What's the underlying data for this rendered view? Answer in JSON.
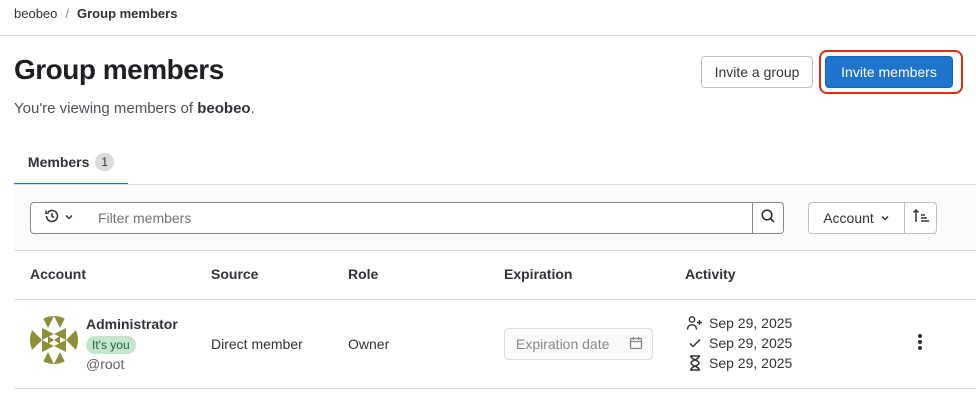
{
  "breadcrumb": {
    "group": "beobeo",
    "separator": "/",
    "current": "Group members"
  },
  "header": {
    "title": "Group members",
    "description_prefix": "You're viewing members of ",
    "description_group": "beobeo",
    "description_suffix": ".",
    "invite_group_label": "Invite a group",
    "invite_members_label": "Invite members"
  },
  "tabs": [
    {
      "label": "Members",
      "count": "1"
    }
  ],
  "filter": {
    "placeholder": "Filter members",
    "sort_label": "Account"
  },
  "table": {
    "columns": [
      "Account",
      "Source",
      "Role",
      "Expiration",
      "Activity"
    ],
    "rows": [
      {
        "name": "Administrator",
        "badge": "It's you",
        "username": "@root",
        "source": "Direct member",
        "role": "Owner",
        "expiration_placeholder": "Expiration date",
        "activity": {
          "member_since": "Sep 29, 2025",
          "last_activity": "Sep 29, 2025",
          "last_sign_in": "Sep 29, 2025"
        }
      }
    ]
  },
  "colors": {
    "primary": "#1f75cb",
    "focus_outline": "#dd2b0e",
    "badge_bg": "#c3e6cd",
    "avatar_fg": "#8f8f3a"
  },
  "icons": [
    "history-icon",
    "chevron-down-icon",
    "search-icon",
    "sort-icon",
    "calendar-icon",
    "user-plus-icon",
    "check-icon",
    "hourglass-icon",
    "more-vertical-icon"
  ]
}
